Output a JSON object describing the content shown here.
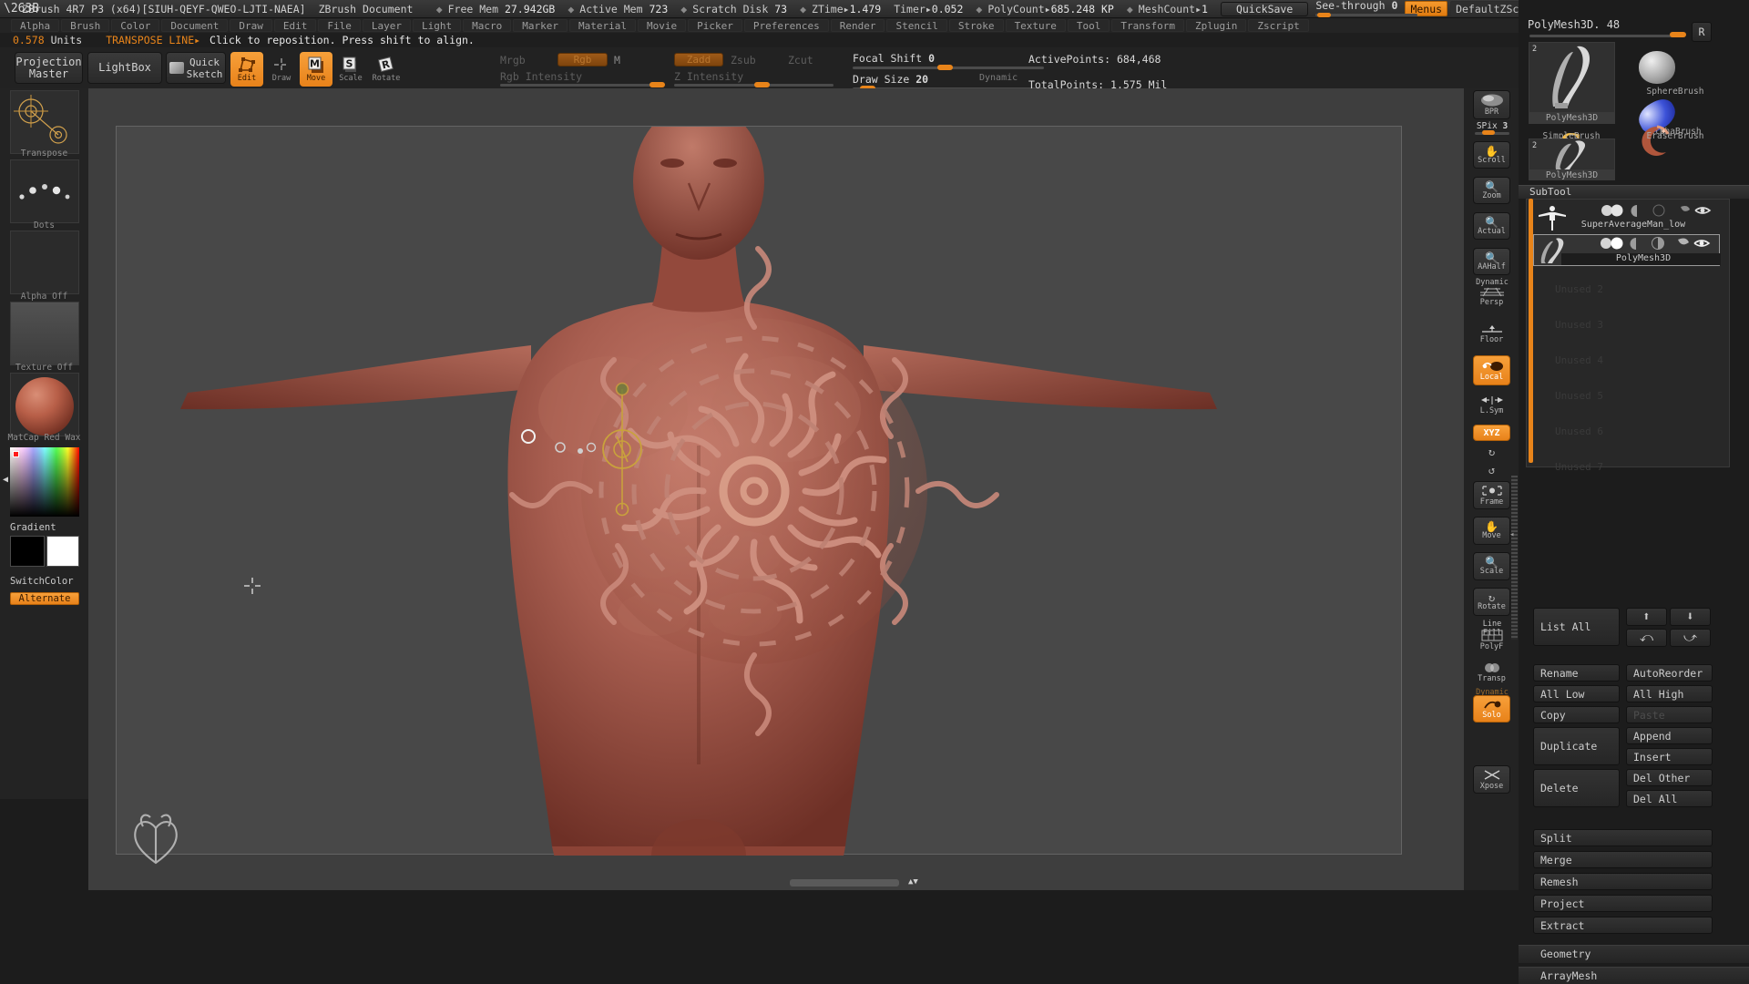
{
  "titlebar": {
    "app_title": "ZBrush 4R7 P3 (x64)[SIUH-QEYF-QWEO-LJTI-NAEA]",
    "document": "ZBrush Document",
    "stats": [
      {
        "label": "Free Mem",
        "value": "27.942GB"
      },
      {
        "label": "Active Mem",
        "value": "723"
      },
      {
        "label": "Scratch Disk",
        "value": "73"
      },
      {
        "label": "ZTime",
        "value": "1.479"
      },
      {
        "label": "Timer",
        "value": "0.052"
      },
      {
        "label": "PolyCount",
        "value": "685.248 KP"
      },
      {
        "label": "MeshCount",
        "value": "1"
      }
    ],
    "quicksave": "QuickSave",
    "seethrough_label": "See-through",
    "seethrough_value": "0",
    "menus_button": "Menus",
    "script_button": "DefaultZScript",
    "icons": [
      "brush-strip-icon",
      "tray-left-icon",
      "tray-right-icon",
      "lock-icon",
      "collapse-icon",
      "restore-icon",
      "close-icon"
    ]
  },
  "menubar": {
    "items": [
      "Alpha",
      "Brush",
      "Color",
      "Document",
      "Draw",
      "Edit",
      "File",
      "Layer",
      "Light",
      "Macro",
      "Marker",
      "Material",
      "Movie",
      "Picker",
      "Preferences",
      "Render",
      "Stencil",
      "Stroke",
      "Texture",
      "Tool",
      "Transform",
      "Zplugin",
      "Zscript"
    ]
  },
  "statusline": {
    "units_value": "0.578",
    "units_label": "Units",
    "mode": "TRANSPOSE LINE▸",
    "hint": "Click to reposition. Press shift to align."
  },
  "toolbar": {
    "projection_master": "Projection\nMaster",
    "lightbox": "LightBox",
    "quick_sketch": "Quick\nSketch",
    "modes": [
      {
        "name": "Edit",
        "label": "Edit",
        "glyph": "edit-poly-icon",
        "selected": true
      },
      {
        "name": "Draw",
        "label": "Draw",
        "glyph": "draw-crosshair-icon",
        "selected": false
      },
      {
        "name": "Move",
        "label": "Move",
        "glyph": "M",
        "selected": true
      },
      {
        "name": "Scale",
        "label": "Scale",
        "glyph": "S",
        "selected": false
      },
      {
        "name": "Rotate",
        "label": "Rotate",
        "glyph": "R",
        "selected": false
      }
    ],
    "mrgb": "Mrgb",
    "rgb": "Rgb",
    "m": "M",
    "rgb_intensity": "Rgb Intensity",
    "zadd": "Zadd",
    "zsub": "Zsub",
    "zcut": "Zcut",
    "z_intensity": "Z Intensity",
    "focal_shift_label": "Focal Shift",
    "focal_shift_value": "0",
    "draw_size_label": "Draw Size",
    "draw_size_value": "20",
    "dynamic": "Dynamic",
    "active_points_label": "ActivePoints:",
    "active_points_value": "684,468",
    "total_points_label": "TotalPoints:",
    "total_points_value": "1.575 Mil"
  },
  "leftpanel": {
    "tiles": [
      {
        "name": "transpose-tool",
        "label": "Transpose"
      },
      {
        "name": "stroke-dots",
        "label": "Dots"
      },
      {
        "name": "alpha",
        "label": "Alpha Off"
      },
      {
        "name": "texture",
        "label": "Texture Off"
      },
      {
        "name": "material",
        "label": "MatCap Red Wax"
      }
    ],
    "gradient_label": "Gradient",
    "switchcolor_label": "SwitchColor",
    "alternate_label": "Alternate"
  },
  "rightstrip": {
    "bpr": "BPR",
    "spix_label": "SPix",
    "spix_value": "3",
    "buttons": [
      {
        "name": "scroll",
        "label": "Scroll",
        "icon": "hand-scroll-icon",
        "selected": false
      },
      {
        "name": "zoom",
        "label": "Zoom",
        "icon": "zoom-plus-icon",
        "selected": false
      },
      {
        "name": "actual",
        "label": "Actual",
        "icon": "zoom-actual-icon",
        "selected": false
      },
      {
        "name": "aahalf",
        "label": "AAHalf",
        "icon": "aahalf-icon",
        "selected": false
      },
      {
        "name": "persp",
        "label": "Persp",
        "icon": "perspective-icon",
        "selected": false,
        "top_label": "Dynamic"
      },
      {
        "name": "floor",
        "label": "Floor",
        "icon": "floor-grid-icon",
        "selected": false
      },
      {
        "name": "local",
        "label": "Local",
        "icon": "local-pivot-icon",
        "selected": true
      },
      {
        "name": "lsym",
        "label": "L.Sym",
        "icon": "local-symmetry-icon",
        "selected": false
      },
      {
        "name": "xyz",
        "label": "XYZ",
        "icon": "xyz-icon",
        "selected": true
      },
      {
        "name": "yrot",
        "label": "",
        "icon": "rotate-y-icon",
        "selected": false
      },
      {
        "name": "zrot",
        "label": "",
        "icon": "rotate-z-icon",
        "selected": false
      },
      {
        "name": "frame",
        "label": "Frame",
        "icon": "frame-icon",
        "selected": false
      },
      {
        "name": "move",
        "label": "Move",
        "icon": "hand-move-icon",
        "selected": false
      },
      {
        "name": "scale",
        "label": "Scale",
        "icon": "scale-icon",
        "selected": false
      },
      {
        "name": "rotate",
        "label": "Rotate",
        "icon": "rotate-icon",
        "selected": false
      },
      {
        "name": "polyf",
        "label": "PolyF",
        "icon": "polyframe-icon",
        "selected": false,
        "top_label": "Line Fill"
      },
      {
        "name": "transp",
        "label": "Transp",
        "icon": "transparency-icon",
        "selected": false
      },
      {
        "name": "solo",
        "label": "Solo",
        "icon": "solo-icon",
        "selected": true,
        "top_label": "Dynamic"
      },
      {
        "name": "xpose",
        "label": "Xpose",
        "icon": "xpose-icon",
        "selected": false
      }
    ]
  },
  "rightpanel": {
    "tool_title": "PolyMesh3D. 48",
    "r_button": "R",
    "tools": [
      {
        "name": "polymesh3d-large",
        "label": "PolyMesh3D",
        "badge": "2",
        "kind": "mesh-thumb"
      },
      {
        "name": "spherebrush",
        "label": "SphereBrush",
        "badge": "",
        "kind": "sphere-thumb"
      },
      {
        "name": "alphabrush",
        "label": "AlphaBrush",
        "badge": "",
        "kind": "alpha-thumb"
      },
      {
        "name": "simplebrush",
        "label": "SimpleBrush",
        "badge": "",
        "kind": "simple-thumb"
      },
      {
        "name": "eraserbrush",
        "label": "EraserBrush",
        "badge": "",
        "kind": "eraser-thumb"
      },
      {
        "name": "polymesh3d-small",
        "label": "PolyMesh3D",
        "badge": "2",
        "kind": "mesh-thumb"
      }
    ],
    "subtool": {
      "title": "SubTool",
      "items": [
        {
          "name": "subtool-superaverageman",
          "label": "SuperAverageMan_low",
          "selected": false
        },
        {
          "name": "subtool-polymesh3d",
          "label": "PolyMesh3D",
          "selected": true
        },
        {
          "name": "subtool-unused-2",
          "label": "Unused 2",
          "selected": false
        },
        {
          "name": "subtool-unused-3",
          "label": "Unused 3",
          "selected": false
        },
        {
          "name": "subtool-unused-4",
          "label": "Unused 4",
          "selected": false
        },
        {
          "name": "subtool-unused-5",
          "label": "Unused 5",
          "selected": false
        },
        {
          "name": "subtool-unused-6",
          "label": "Unused 6",
          "selected": false
        },
        {
          "name": "subtool-unused-7",
          "label": "Unused 7",
          "selected": false
        }
      ],
      "list_all": "List All",
      "buttons": [
        {
          "name": "rename",
          "label": "Rename",
          "dim": false
        },
        {
          "name": "autoreorder",
          "label": "AutoReorder",
          "dim": false
        },
        {
          "name": "all-low",
          "label": "All Low",
          "dim": false
        },
        {
          "name": "all-high",
          "label": "All High",
          "dim": false
        },
        {
          "name": "copy",
          "label": "Copy",
          "dim": false
        },
        {
          "name": "paste",
          "label": "Paste",
          "dim": true
        },
        {
          "name": "duplicate",
          "label": "Duplicate",
          "dim": false
        },
        {
          "name": "append",
          "label": "Append",
          "dim": false
        },
        {
          "name": "insert",
          "label": "Insert",
          "dim": false
        },
        {
          "name": "delete",
          "label": "Delete",
          "dim": false
        },
        {
          "name": "del-other",
          "label": "Del Other",
          "dim": false
        },
        {
          "name": "del-all",
          "label": "Del All",
          "dim": false
        },
        {
          "name": "split",
          "label": "Split",
          "dim": false
        },
        {
          "name": "merge",
          "label": "Merge",
          "dim": false
        },
        {
          "name": "remesh",
          "label": "Remesh",
          "dim": false
        },
        {
          "name": "project",
          "label": "Project",
          "dim": false
        },
        {
          "name": "extract",
          "label": "Extract",
          "dim": false
        }
      ]
    },
    "sections": [
      {
        "name": "geometry",
        "label": "Geometry"
      },
      {
        "name": "arraymesh",
        "label": "ArrayMesh"
      }
    ]
  },
  "canvas": {
    "model_name": "male-torso-sculpt",
    "overlay": "transpose-line-gizmo",
    "cursor": "crosshair-cursor"
  }
}
